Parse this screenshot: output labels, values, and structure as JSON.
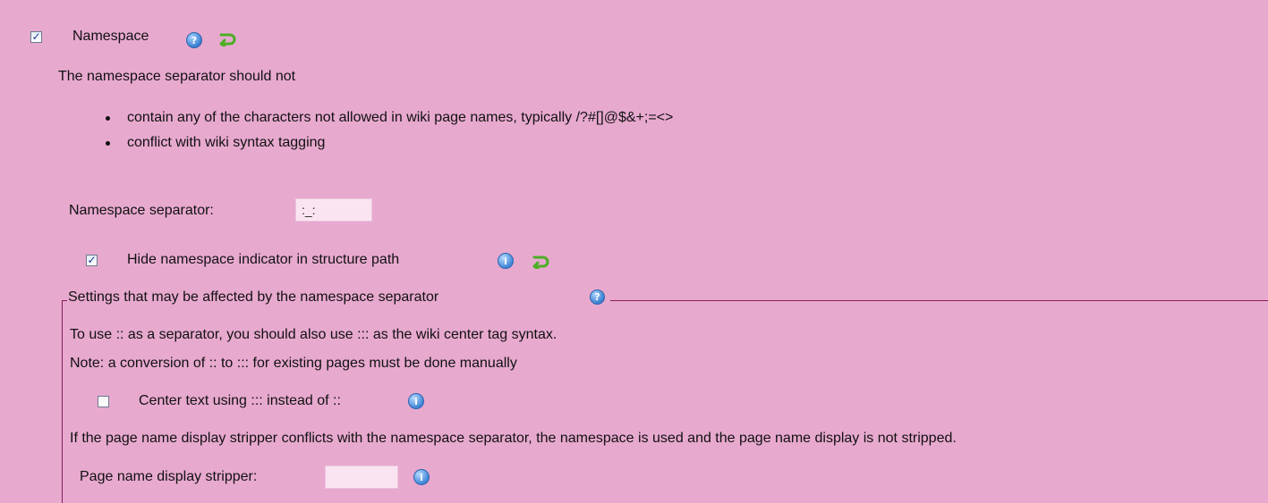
{
  "namespace": {
    "label": "Namespace",
    "checked": true,
    "intro": "The namespace separator should not",
    "rules": [
      "contain any of the characters not allowed in wiki page names, typically /?#[]@$&+;=<>",
      "conflict with wiki syntax tagging"
    ]
  },
  "separator_field": {
    "label": "Namespace separator:",
    "value": ":_:"
  },
  "hide_indicator": {
    "label": "Hide namespace indicator in structure path",
    "checked": true
  },
  "affected": {
    "legend": "Settings that may be affected by the namespace separator",
    "line1": "To use :: as a separator, you should also use ::: as the wiki center tag syntax.",
    "line2": "Note: a conversion of :: to ::: for existing pages must be done manually",
    "center_text": {
      "label": "Center text using ::: instead of ::",
      "checked": false
    },
    "stripper_note": "If the page name display stripper conflicts with the namespace separator, the namespace is used and the page name display is not stripped.",
    "stripper_field": {
      "label": "Page name display stripper:",
      "value": ""
    }
  },
  "icons": {
    "help": "help-icon",
    "info": "info-icon",
    "reset": "reset-icon",
    "check": "✓"
  },
  "colors": {
    "background": "#e8a9cf",
    "input_bg": "#fbe4f2",
    "fieldset_border": "#8a1b5e"
  }
}
